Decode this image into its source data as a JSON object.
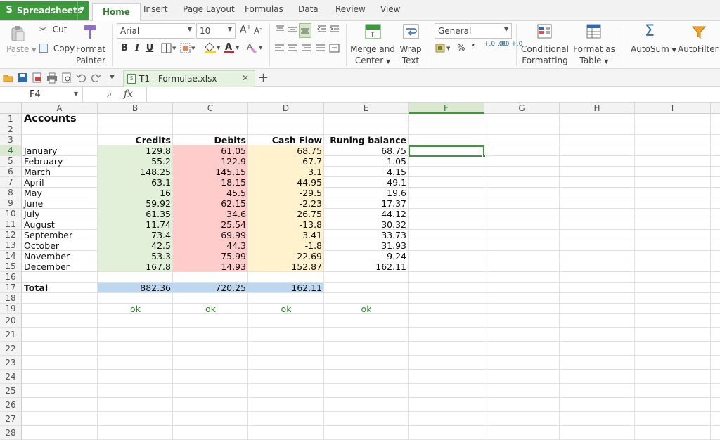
{
  "app": {
    "name": "Spreadsheets",
    "menu_tabs": [
      "Home",
      "Insert",
      "Page Layout",
      "Formulas",
      "Data",
      "Review",
      "View"
    ],
    "active_tab": "Home"
  },
  "ribbon": {
    "clipboard": {
      "paste": "Paste",
      "cut": "Cut",
      "copy": "Copy",
      "format_painter_line1": "Format",
      "format_painter_line2": "Painter"
    },
    "font": {
      "name": "Arial",
      "size": "10",
      "bold": "B",
      "italic": "I",
      "underline": "U"
    },
    "alignment": {
      "merge_line1": "Merge and",
      "merge_line2": "Center",
      "wrap_line1": "Wrap",
      "wrap_line2": "Text"
    },
    "number": {
      "format": "General",
      "percent": "%",
      "comma": "ʼ",
      "inc_decimal": "+.0 .00",
      "dec_decimal": ".00 +.0"
    },
    "styles": {
      "conditional_line1": "Conditional",
      "conditional_line2": "Formatting",
      "format_table_line1": "Format as",
      "format_table_line2": "Table"
    },
    "editing": {
      "autosum": "AutoSum",
      "autofilter": "AutoFilter"
    }
  },
  "document": {
    "tab_title": "T1 - Formulae.xlsx"
  },
  "formula_bar": {
    "cell_ref": "F4",
    "fx_label": "fx",
    "value": ""
  },
  "grid": {
    "columns": [
      "A",
      "B",
      "C",
      "D",
      "E",
      "F",
      "G",
      "H",
      "I"
    ],
    "selected_column": "F",
    "rows": [
      "1",
      "2",
      "3",
      "4",
      "5",
      "6",
      "7",
      "8",
      "9",
      "10",
      "11",
      "12",
      "13",
      "14",
      "15",
      "16",
      "17",
      "18",
      "19",
      "20",
      "21",
      "22",
      "23",
      "24",
      "25",
      "26",
      "27",
      "28"
    ],
    "selected_row": "4",
    "title": "Accounts",
    "headers": {
      "credits": "Credits",
      "debits": "Debits",
      "cash_flow": "Cash Flow",
      "running_balance": "Runing balance"
    },
    "data": [
      {
        "month": "January",
        "credits": "129.8",
        "debits": "61.05",
        "cash_flow": "68.75",
        "balance": "68.75"
      },
      {
        "month": "February",
        "credits": "55.2",
        "debits": "122.9",
        "cash_flow": "-67.7",
        "balance": "1.05"
      },
      {
        "month": "March",
        "credits": "148.25",
        "debits": "145.15",
        "cash_flow": "3.1",
        "balance": "4.15"
      },
      {
        "month": "April",
        "credits": "63.1",
        "debits": "18.15",
        "cash_flow": "44.95",
        "balance": "49.1"
      },
      {
        "month": "May",
        "credits": "16",
        "debits": "45.5",
        "cash_flow": "-29.5",
        "balance": "19.6"
      },
      {
        "month": "June",
        "credits": "59.92",
        "debits": "62.15",
        "cash_flow": "-2.23",
        "balance": "17.37"
      },
      {
        "month": "July",
        "credits": "61.35",
        "debits": "34.6",
        "cash_flow": "26.75",
        "balance": "44.12"
      },
      {
        "month": "August",
        "credits": "11.74",
        "debits": "25.54",
        "cash_flow": "-13.8",
        "balance": "30.32"
      },
      {
        "month": "September",
        "credits": "73.4",
        "debits": "69.99",
        "cash_flow": "3.41",
        "balance": "33.73"
      },
      {
        "month": "October",
        "credits": "42.5",
        "debits": "44.3",
        "cash_flow": "-1.8",
        "balance": "31.93"
      },
      {
        "month": "November",
        "credits": "53.3",
        "debits": "75.99",
        "cash_flow": "-22.69",
        "balance": "9.24"
      },
      {
        "month": "December",
        "credits": "167.8",
        "debits": "14.93",
        "cash_flow": "152.87",
        "balance": "162.11"
      }
    ],
    "total": {
      "label": "Total",
      "credits": "882.36",
      "debits": "720.25",
      "cash_flow": "162.11"
    },
    "checks": [
      "ok",
      "ok",
      "ok",
      "ok"
    ]
  },
  "colors": {
    "brand_green": "#3c9a3c",
    "credits_fill": "#e2efd9",
    "debits_fill": "#ffcccc",
    "cashflow_fill": "#fff2cc",
    "total_fill": "#bdd7ee",
    "ok_text": "#2f8a2f"
  }
}
